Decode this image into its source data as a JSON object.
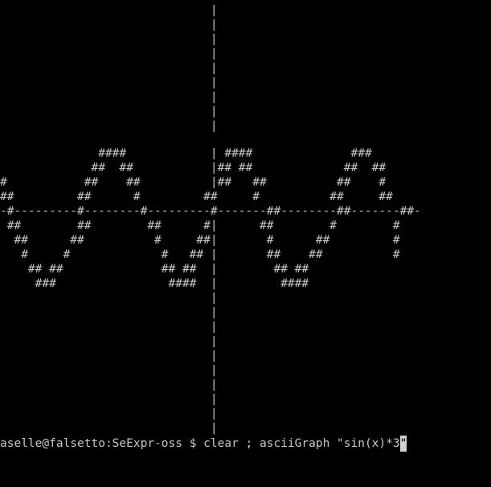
{
  "terminal": {
    "screen_lines": [
      "",
      "                              |",
      "                              |",
      "                              |",
      "                              |",
      "                              |",
      "                              |",
      "                              |",
      "                              |",
      "                              |",
      "              ####            | ####              ###",
      "             ##  ##           |## ##             ##  ##",
      "#           ##    ##          |##   ##          ##    #",
      "##         ##      #         ##     #          ##     ##",
      "-#---------#--------#---------#-------##--------##-------##-",
      " ##        ##        ##      #|      ##        #        #",
      "  ##      ##          #     ##|       #      ##         #",
      "   #     #             #   ## |       ##    ##          #",
      "    ## ##              ## ##  |        ## ##",
      "     ###                ####  |         ####",
      "                              |",
      "                              |",
      "                              |",
      "                              |",
      "                              |",
      "                              |",
      "                              |",
      "                              |",
      "                              |",
      "                              |"
    ],
    "prompt": {
      "text": "aselle@falsetto:SeExpr-oss $ clear ; asciiGraph \"sin(x)*3",
      "cursor_char": "\""
    }
  }
}
